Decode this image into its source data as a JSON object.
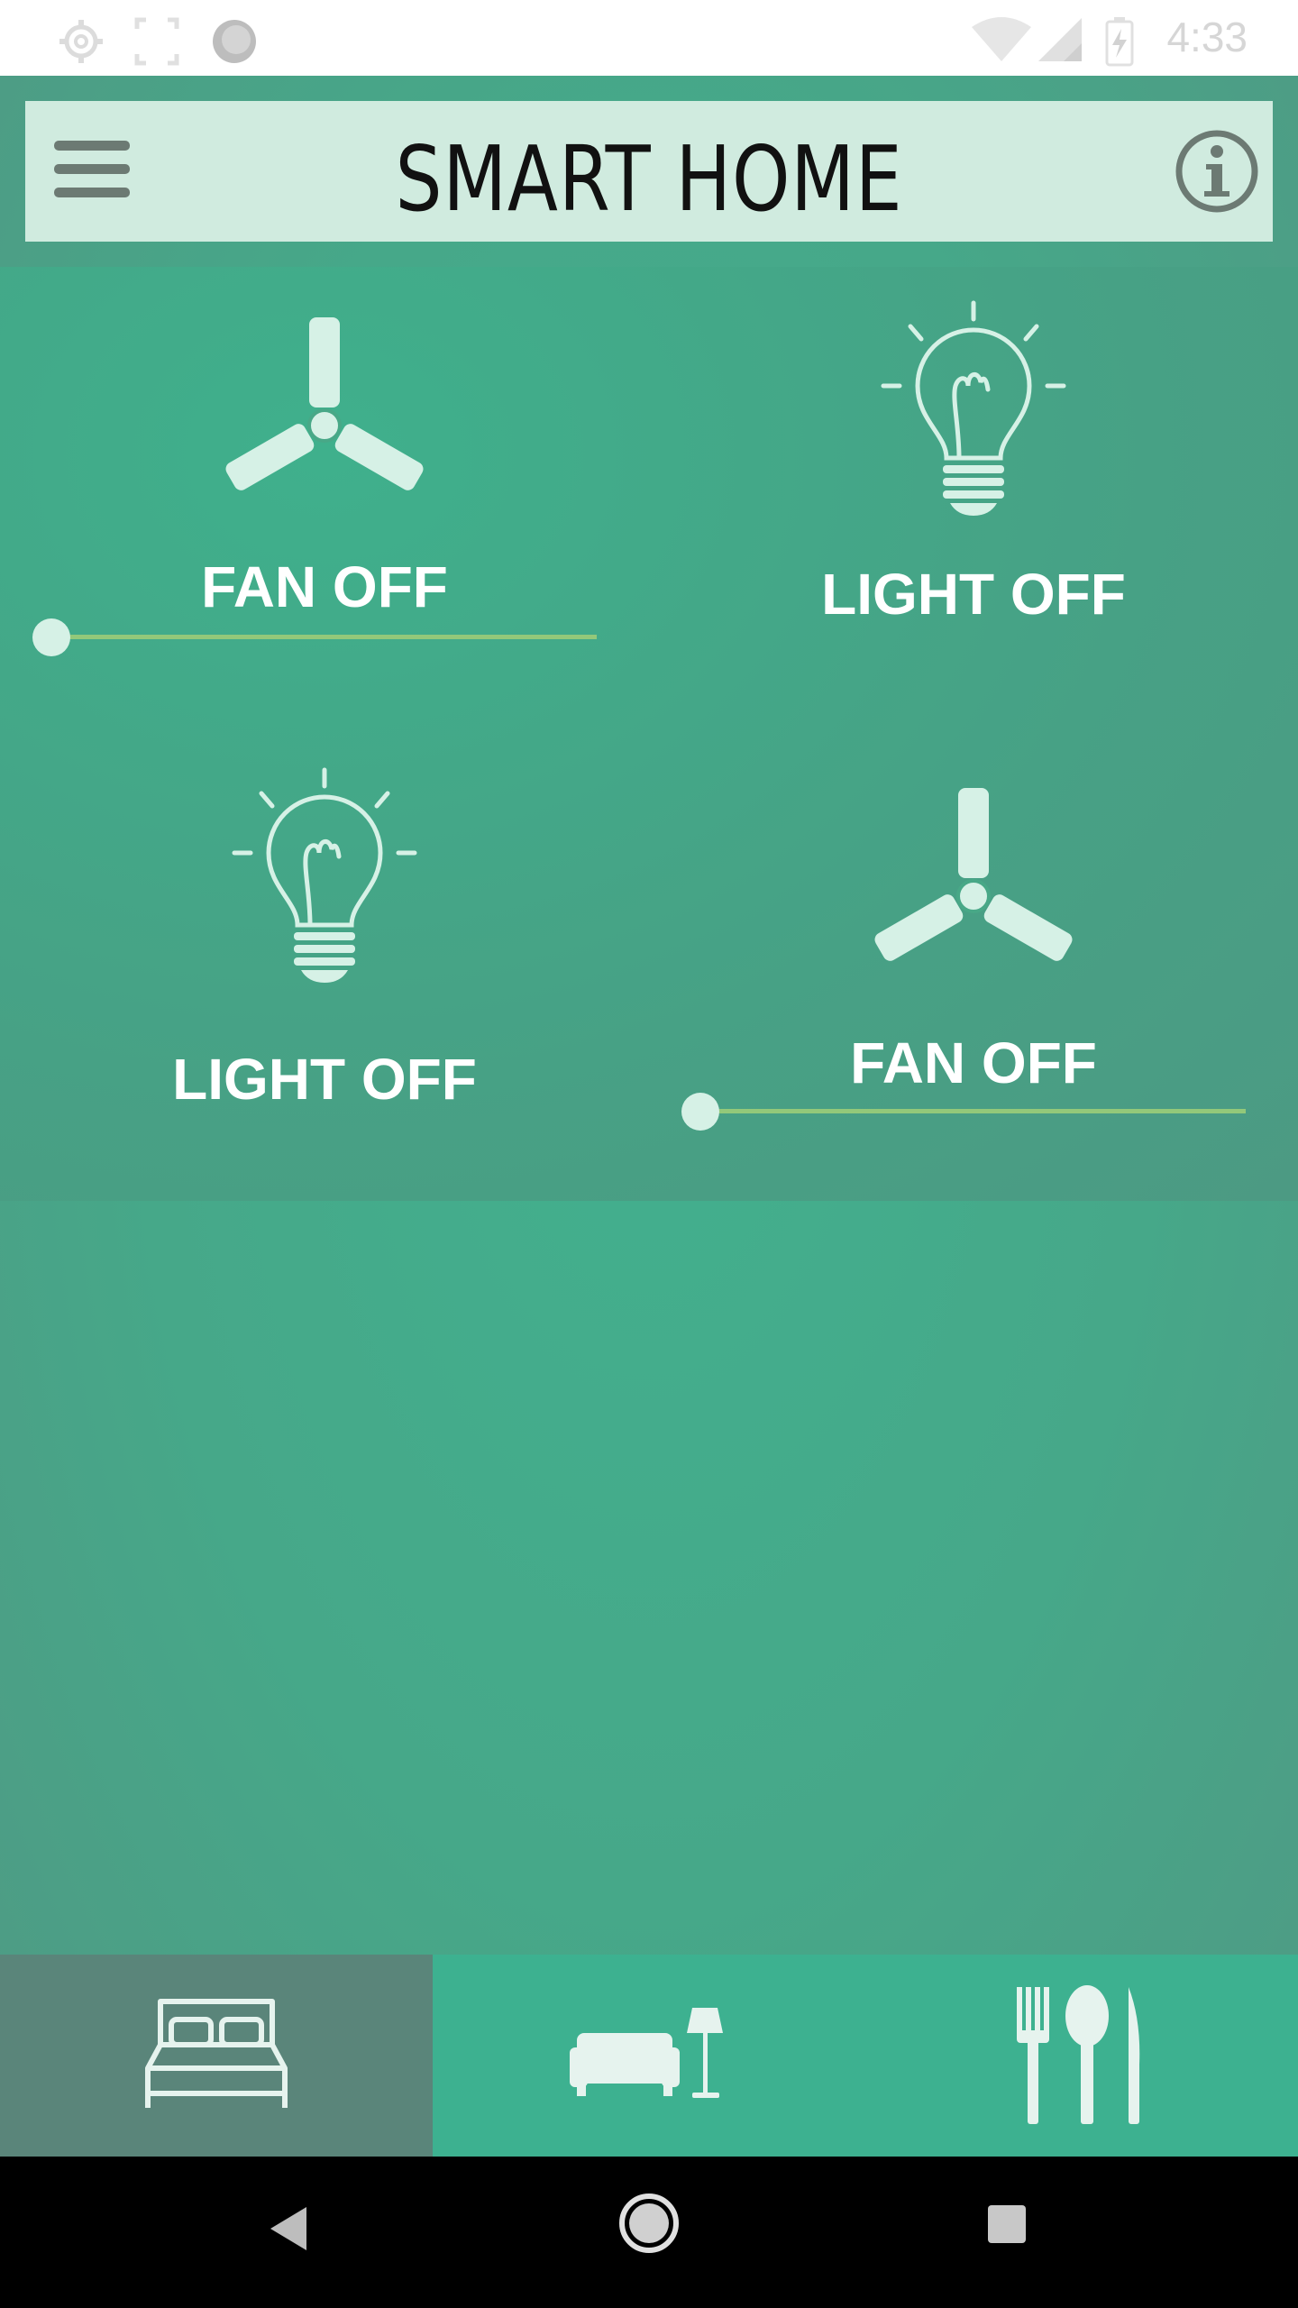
{
  "status_bar": {
    "time": "4:33",
    "icons": [
      "settings-icon",
      "screenshot-icon",
      "record-icon",
      "wifi-icon",
      "signal-icon",
      "battery-charging-icon"
    ]
  },
  "toolbar": {
    "title": "SMART HOME",
    "menu_icon": "hamburger-menu-icon",
    "info_icon": "info-icon"
  },
  "devices": [
    {
      "type": "fan",
      "label": "FAN OFF",
      "icon": "fan-icon",
      "speed": 0
    },
    {
      "type": "light",
      "label": "LIGHT OFF",
      "icon": "light-bulb-icon"
    },
    {
      "type": "light",
      "label": "LIGHT OFF",
      "icon": "light-bulb-icon"
    },
    {
      "type": "fan",
      "label": "FAN OFF",
      "icon": "fan-icon",
      "speed": 0
    }
  ],
  "bottom_nav": {
    "items": [
      {
        "icon": "bed-icon",
        "room": "bedroom",
        "active": true
      },
      {
        "icon": "sofa-lamp-icon",
        "room": "living room",
        "active": false
      },
      {
        "icon": "cutlery-icon",
        "room": "kitchen",
        "active": false
      }
    ]
  },
  "system_nav": {
    "buttons": [
      "back-icon",
      "home-icon",
      "recents-icon"
    ]
  },
  "colors": {
    "background": "#3fae8c",
    "toolbar": "#d0ebdf",
    "active_tab": "#5a857a",
    "slider_track": "#93c87a",
    "icon_tint": "#d6f1e6"
  }
}
